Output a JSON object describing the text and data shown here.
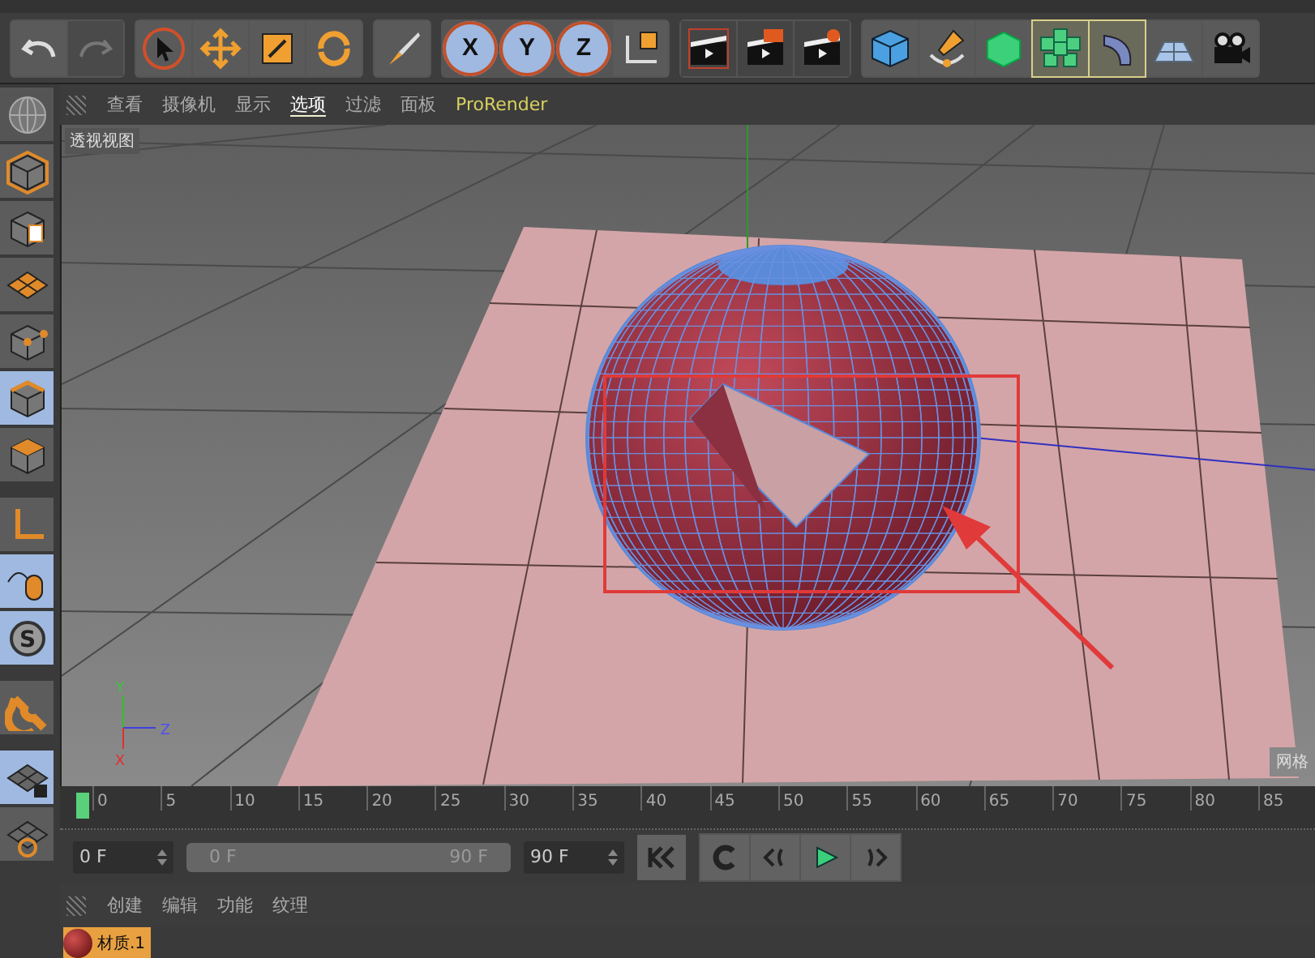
{
  "toolbar": {
    "axis_buttons": [
      {
        "label": "X",
        "selected": true
      },
      {
        "label": "Y",
        "selected": true
      },
      {
        "label": "Z",
        "selected": true
      }
    ]
  },
  "left_toolbar": [
    {
      "kind": "model",
      "selected": false
    },
    {
      "kind": "texture",
      "selected": false
    },
    {
      "kind": "workplane",
      "selected": false
    },
    {
      "kind": "points",
      "selected": false
    },
    {
      "kind": "edges",
      "selected": true
    },
    {
      "kind": "polygons",
      "selected": false
    },
    {
      "kind": "axis",
      "selected": false
    },
    {
      "kind": "tweak",
      "selected": true
    },
    {
      "kind": "solo",
      "selected": true,
      "label": "S"
    },
    {
      "kind": "snap",
      "selected": false
    },
    {
      "kind": "lock",
      "selected": true
    },
    {
      "kind": "workplane-sync",
      "selected": false
    }
  ],
  "viewport_menu": [
    {
      "label": "查看",
      "selected": false
    },
    {
      "label": "摄像机",
      "selected": false
    },
    {
      "label": "显示",
      "selected": false
    },
    {
      "label": "选项",
      "selected": true
    },
    {
      "label": "过滤",
      "selected": false
    },
    {
      "label": "面板",
      "selected": false
    },
    {
      "label": "ProRender",
      "selected": false
    }
  ],
  "viewport": {
    "title": "透视视图",
    "axis_labels": [
      "Y",
      "Z",
      "X"
    ],
    "corner_label": "网格"
  },
  "timeline": {
    "ticks": [
      "0",
      "5",
      "10",
      "15",
      "20",
      "25",
      "30",
      "35",
      "40",
      "45",
      "50",
      "55",
      "60",
      "65",
      "70",
      "75",
      "80",
      "85"
    ],
    "start_field": "0 F",
    "range_slider": {
      "start": "0 F",
      "end": "90 F",
      "level": 1
    },
    "end_field": "90 F"
  },
  "material_menu": [
    "创建",
    "编辑",
    "功能",
    "纹理"
  ],
  "materials": [
    {
      "name": "材质.1",
      "selected": true
    }
  ]
}
